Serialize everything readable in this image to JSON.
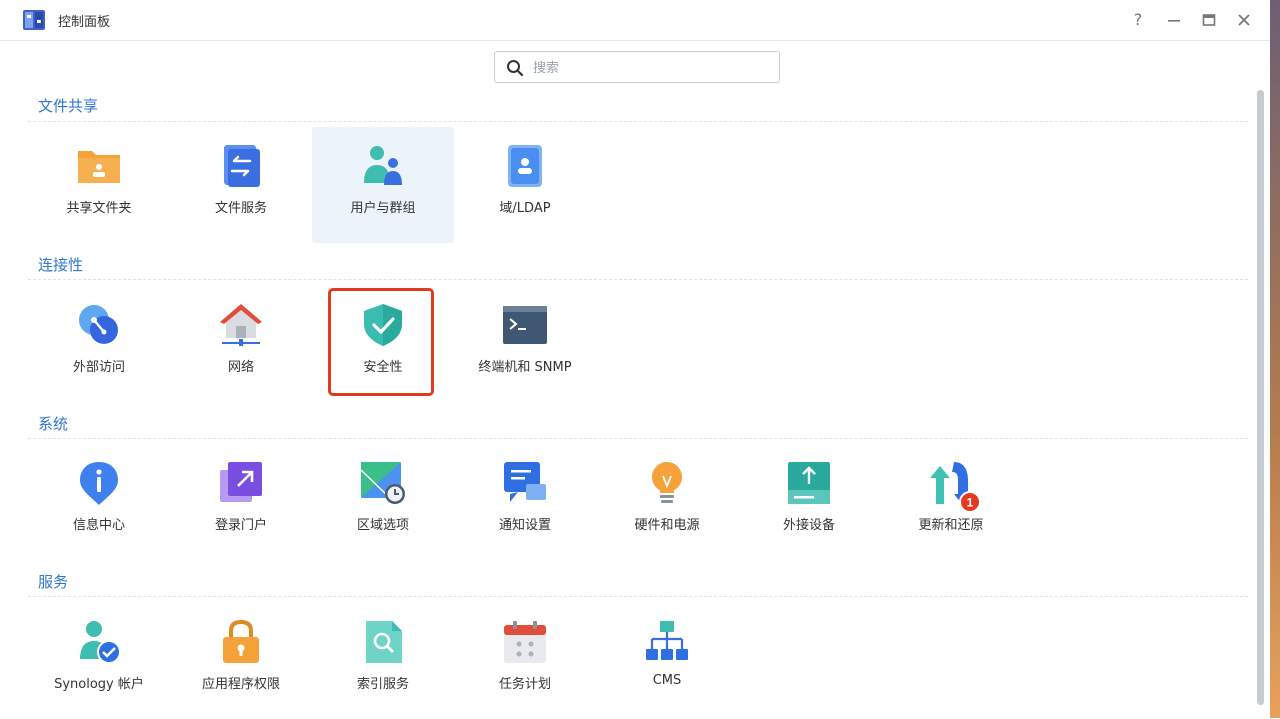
{
  "window": {
    "title": "控制面板",
    "buttons": {
      "help": "?"
    }
  },
  "search": {
    "placeholder": "搜索",
    "value": ""
  },
  "sections": [
    {
      "title": "文件共享",
      "items": [
        "共享文件夹",
        "文件服务",
        "用户与群组",
        "域/LDAP"
      ]
    },
    {
      "title": "连接性",
      "items": [
        "外部访问",
        "网络",
        "安全性",
        "终端机和 SNMP"
      ]
    },
    {
      "title": "系统",
      "items": [
        "信息中心",
        "登录门户",
        "区域选项",
        "通知设置",
        "硬件和电源",
        "外接设备",
        "更新和还原"
      ]
    },
    {
      "title": "服务",
      "items": [
        "Synology 帐户",
        "应用程序权限",
        "索引服务",
        "任务计划",
        "CMS"
      ]
    }
  ],
  "badges": {
    "update_count": "1"
  },
  "selected_item": "用户与群组",
  "highlighted_item": "安全性",
  "colors": {
    "accent": "#2f77d1",
    "highlight": "#e5391f",
    "selected_bg": "#edf3fb"
  }
}
